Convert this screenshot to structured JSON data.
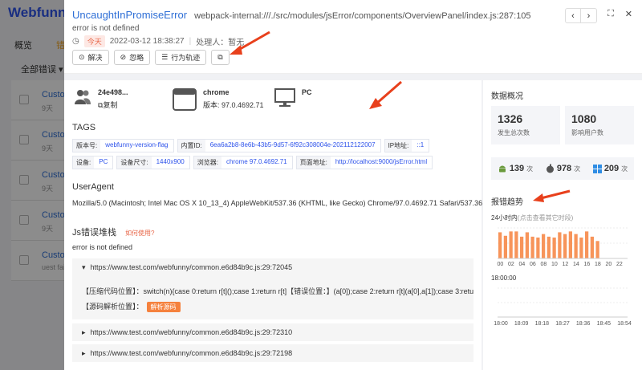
{
  "background": {
    "logo": "Webfunny",
    "nav_overview": "概览",
    "nav_active": "错",
    "filter_label": "全部错误",
    "rows": [
      {
        "title": "Custo",
        "sub": "9天"
      },
      {
        "title": "Custo",
        "sub": "9天"
      },
      {
        "title": "Custo",
        "sub": "9天"
      },
      {
        "title": "Custo",
        "sub": "9天"
      },
      {
        "title": "Custo",
        "sub": "uest fail"
      }
    ]
  },
  "header": {
    "error_name": "UncaughtInPromiseError",
    "error_path": "webpack-internal:///./src/modules/jsError/components/OverviewPanel/index.js:287:105",
    "error_message": "error is not defined",
    "today_tag": "今天",
    "datetime": "2022-03-12 18:38:27",
    "handler_label": "处理人：",
    "handler_value": "暂无",
    "actions": [
      {
        "label": "解决",
        "icon": "check-circle-icon"
      },
      {
        "label": "忽略",
        "icon": "ban-icon"
      },
      {
        "label": "行为轨迹",
        "icon": "list-icon"
      },
      {
        "label": "",
        "icon": "external-link-icon"
      }
    ]
  },
  "env": {
    "user_id": "24e498...",
    "copy_label": "复制",
    "browser": "chrome",
    "browser_version": "版本: 97.0.4692.71",
    "device": "PC"
  },
  "tags_title": "TAGS",
  "tags": [
    {
      "key": "版本号:",
      "value": "webfunny-version-flag"
    },
    {
      "key": "内置ID:",
      "value": "6ea6a2b8-8e6b-43b5-9d57-6f92c308004e-202112122007"
    },
    {
      "key": "IP地址:",
      "value": "::1"
    },
    {
      "key": "设备:",
      "value": "PC"
    },
    {
      "key": "设备尺寸:",
      "value": "1440x900"
    },
    {
      "key": "浏览器:",
      "value": "chrome 97.0.4692.71"
    },
    {
      "key": "页面地址:",
      "value": "http://localhost:9000/jsError.html"
    }
  ],
  "useragent_title": "UserAgent",
  "useragent": "Mozilla/5.0 (Macintosh; Intel Mac OS X 10_13_4) AppleWebKit/537.36 (KHTML, like Gecko) Chrome/97.0.4692.71 Safari/537.36",
  "stack_title": "Js错误堆栈",
  "stack_help": "如何使用?",
  "stack_message": "error is not defined",
  "stack": [
    {
      "url": "https://www.test.com/webfunny/common.e6d84b9c.js:29:72045",
      "expanded": true,
      "compressed_label": "【压缩代码位置】：",
      "compressed_code": "switch(n){case 0:return r[t]();case 1:return r[t]【错误位置：】(a[0]);case 2:return r[t](a[0],a[1]);case 3:retu",
      "source_label": "【源码解析位置】：",
      "parse_button": "解析源码"
    },
    {
      "url": "https://www.test.com/webfunny/common.e6d84b9c.js:29:72310",
      "expanded": false
    },
    {
      "url": "https://www.test.com/webfunny/common.e6d84b9c.js:29:72198",
      "expanded": false
    }
  ],
  "side": {
    "overview_title": "数据概况",
    "total_count": "1326",
    "total_label": "发生总次数",
    "users_count": "1080",
    "users_label": "影响用户数",
    "platforms": [
      {
        "name": "android-icon",
        "count": "139",
        "unit": "次"
      },
      {
        "name": "apple-icon",
        "count": "978",
        "unit": "次"
      },
      {
        "name": "windows-icon",
        "count": "209",
        "unit": "次"
      }
    ],
    "trend_title": "报错趋势",
    "trend_sub": "24小时内",
    "trend_sub_note": "(点击查看其它时段)",
    "detail_time": "18:00:00"
  },
  "colors": {
    "accent": "#2f54eb",
    "bar": "#f7945a",
    "arrow": "#e8401c"
  },
  "chart_data": [
    {
      "type": "bar",
      "title": "",
      "categories": [
        "00",
        "01",
        "02",
        "03",
        "04",
        "05",
        "06",
        "07",
        "08",
        "09",
        "10",
        "11",
        "12",
        "13",
        "14",
        "15",
        "16",
        "17",
        "18",
        "19",
        "20",
        "21",
        "22",
        "23"
      ],
      "tick_labels": [
        "00",
        "02",
        "04",
        "06",
        "08",
        "10",
        "12",
        "14",
        "16",
        "18",
        "20",
        "22"
      ],
      "values": [
        30,
        26,
        31,
        31,
        25,
        30,
        25,
        24,
        28,
        25,
        24,
        30,
        28,
        31,
        28,
        24,
        31,
        25,
        20,
        0,
        0,
        0,
        0,
        0
      ],
      "ylim": [
        0,
        35
      ]
    },
    {
      "type": "line",
      "title": "",
      "x": [
        "18:00",
        "18:09",
        "18:18",
        "18:27",
        "18:36",
        "18:45",
        "18:54"
      ],
      "values": [
        0,
        0,
        0,
        0,
        0,
        0,
        0
      ]
    }
  ]
}
